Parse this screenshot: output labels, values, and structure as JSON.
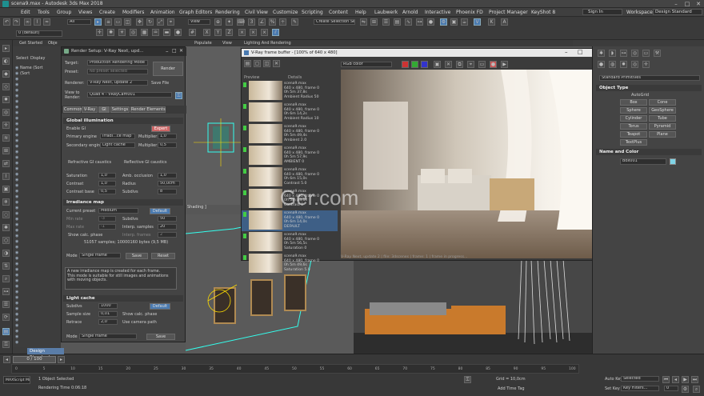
{
  "window": {
    "title": "scena9.max - Autodesk 3ds Max 2018"
  },
  "menu": [
    "Edit",
    "Tools",
    "Group",
    "Views",
    "Create",
    "Modifiers",
    "Animation",
    "Graph Editors",
    "Rendering",
    "Civil View",
    "Customize",
    "Scripting",
    "Content",
    "Help",
    "Laubwerk",
    "Arnold",
    "Interactive",
    "Phoenix FD",
    "Project Manager",
    "KeyShot 8"
  ],
  "account": {
    "sign_in": "Sign In",
    "workspaces_label": "Workspaces:",
    "workspace": "Design Standard"
  },
  "toolbar": {
    "filter": "All",
    "view": "View",
    "selection_set": "Create Selection Se",
    "layer": "0 (default)"
  },
  "ribbon": {
    "tabs": [
      "Get Started",
      "Obje",
      "Populate",
      "View",
      "Lighting And Rendering"
    ]
  },
  "scene_explorer": {
    "tabs": [
      "Select",
      "Display"
    ],
    "rows": [
      "Name (Sort",
      "(Sort",
      "",
      "",
      "",
      "",
      "",
      "",
      "",
      "",
      "",
      "",
      "",
      "",
      "",
      "",
      "",
      "",
      "",
      "",
      "",
      "",
      "",
      "",
      "",
      "",
      "",
      "",
      "",
      "",
      "",
      "",
      "",
      "",
      "",
      "",
      "",
      "",
      "",
      "",
      "",
      "",
      "",
      "",
      "",
      "",
      "",
      "",
      "",
      ""
    ]
  },
  "render_setup": {
    "title": "Render Setup: V-Ray Next, upd...",
    "target_label": "Target:",
    "target": "Production Rendering Mode",
    "render_btn": "Render",
    "preset_label": "Preset:",
    "preset": "No preset selected",
    "renderer_label": "Renderer:",
    "renderer": "V-Ray Next, update 2",
    "save_file": "Save File",
    "view_label": "View to Render:",
    "view": "Quad 4 - VRayCam001",
    "tabs": [
      "Common",
      "V-Ray",
      "GI",
      "Settings",
      "Render Elements"
    ],
    "gi_section": "Global illumination",
    "enable_gi": "Enable GI",
    "expert": "Expert",
    "primary_label": "Primary engine",
    "primary": "Irradi...ce map",
    "mult_label": "Multiplier",
    "primary_mult": "1,0",
    "secondary_label": "Secondary engine",
    "secondary": "Light cache",
    "secondary_mult": "0,5",
    "refractive": "Refractive GI caustics",
    "reflective": "Reflective GI caustics",
    "saturation_label": "Saturation",
    "saturation": "1,0",
    "amb_occ": "Amb. occlusion",
    "amb_occ_val": "1,0",
    "contrast_label": "Contrast",
    "contrast": "1,0",
    "radius_label": "Radius",
    "radius": "50,0cm",
    "contrast_base_label": "Contrast base",
    "contrast_base": "0,5",
    "subdivs_label": "Subdivs",
    "ao_subdivs": "8",
    "irr_section": "Irradiance map",
    "cur_preset_label": "Current preset",
    "cur_preset": "Medium",
    "default_btn": "Default",
    "min_rate_label": "Min rate",
    "min_rate": "-3",
    "subdivs_val": "50",
    "max_rate_label": "Max rate",
    "max_rate": "-1",
    "interp_label": "Interp. samples",
    "interp": "20",
    "show_calc": "Show calc. phase",
    "interp_frames": "Interp. frames",
    "interp_frames_val": "2",
    "samples_info": "51057 samples; 10000160 bytes (9,5 MB)",
    "mode_label": "Mode",
    "mode": "Single frame",
    "save_btn": "Save",
    "reset_btn": "Reset",
    "irr_desc": "A new irradiance map is created for each frame.\nThis mode is suitable for still images and animations with moving objects.",
    "lc_section": "Light cache",
    "lc_subdivs_label": "Subdivs",
    "lc_subdivs": "1000",
    "lc_default": "Default",
    "sample_size_label": "Sample size",
    "sample_size": "0,01",
    "lc_show_calc": "Show calc. phase",
    "retrace": "Retrace",
    "retrace_val": "2,0",
    "use_cam": "Use camera path",
    "lc_mode_label": "Mode",
    "lc_mode": "Single frame",
    "lc_save": "Save"
  },
  "frame_buffer": {
    "title": "V-Ray frame buffer - [100% of 640 x 480]",
    "preview_label": "Preview",
    "details_label": "Details",
    "channel": "RGB color",
    "history": [
      {
        "info": "scena9.max\n640 x 480, frame 0\n0h 5m 37,8s\nAmbient Radius 50"
      },
      {
        "info": "scena9.max\n640 x 480, frame 0\n0h 6m 14,2s\nAmbient Radius 10"
      },
      {
        "info": "scena9.max\n640 x 480, frame 0\n0h 5m 49,4s\nAmbient 2.0"
      },
      {
        "info": "scena9.max\n640 x 480, frame 0\n0h 5m 57,9s\nAMBIENT 0"
      },
      {
        "info": "scena9.max\n640 x 480, frame 0\n0h 6m 15,0s\nContrast 5.0"
      },
      {
        "info": "scena9.max\n640 x 480, frame 0\n0h 5m 33,1s\nContrast 0"
      },
      {
        "info": "scena9.max\n640 x 480, frame 0\n0h 6m 14,0s\nDEFAULT"
      },
      {
        "info": "scena9.max\n640 x 480, frame 0\n0h 5m 56,5s\nSaturation 0"
      },
      {
        "info": "scena9.max\n640 x 480, frame 0\n0h 5m 49,6s\nSaturation 5.0"
      }
    ],
    "status": "V-Ray Next, update 2 | file: 3dscenes | frame: 1 | frame in progress..."
  },
  "watermark": "Ger.com",
  "viewport": {
    "label": "Shading ]"
  },
  "command_panel": {
    "dropdown": "Standard Primitives",
    "rollout": "Object Type",
    "autogrid": "AutoGrid",
    "objects": [
      "Box",
      "Cone",
      "Sphere",
      "GeoSphere",
      "Cylinder",
      "Tube",
      "Torus",
      "Pyramid",
      "Teapot",
      "Plane",
      "TextPlus"
    ],
    "name_color": "Name and Color",
    "name_value": "Box001",
    "name_color_hex": "#7fd4e6"
  },
  "timeline": {
    "frame": "0 / 100",
    "workspace": "Design Standard",
    "ticks": [
      "0",
      "5",
      "10",
      "15",
      "20",
      "25",
      "30",
      "35",
      "40",
      "45",
      "50",
      "55",
      "60",
      "65",
      "70",
      "75",
      "80",
      "85",
      "90",
      "95",
      "100"
    ]
  },
  "status": {
    "selected": "1 Object Selected",
    "render_time": "Rendering Time 0:06:18",
    "grid": "Grid = 10,0cm",
    "add_time_tag": "Add Time Tag",
    "auto_key": "Auto Key",
    "set_key": "Set Key",
    "selected_dd": "Selected",
    "key_filters": "Key Filters...",
    "frame_field": "0",
    "script": "MAXScript Mi"
  }
}
